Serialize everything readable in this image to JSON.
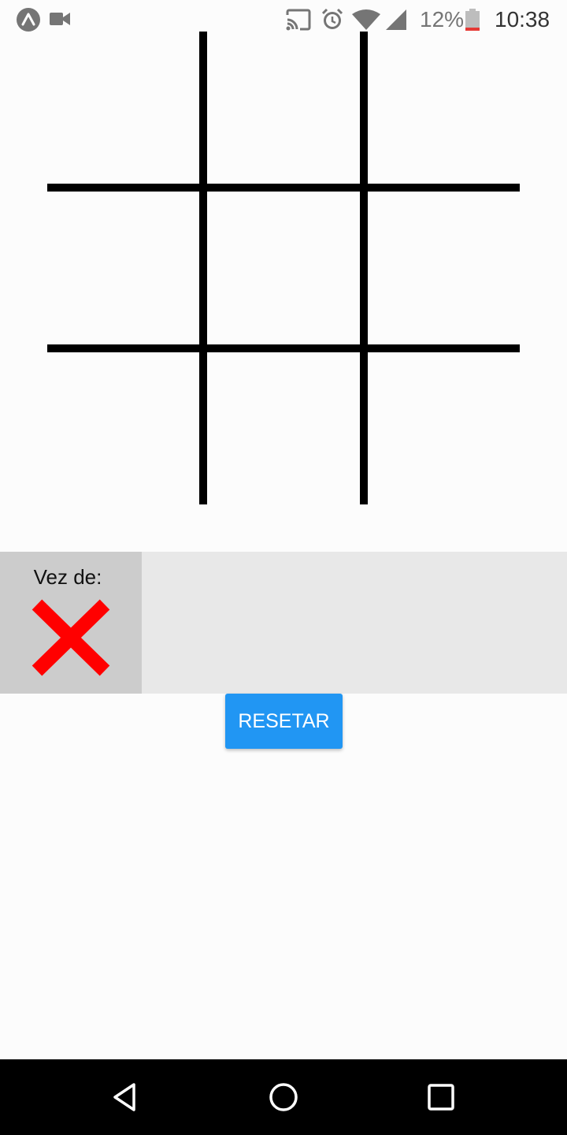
{
  "status_bar": {
    "icons_left": [
      "expo-icon",
      "video-camera-icon"
    ],
    "icons_right": [
      "cast-icon",
      "alarm-icon",
      "wifi-icon",
      "signal-icon",
      "battery-icon"
    ],
    "battery_percent": "12%",
    "clock": "10:38",
    "battery_low_color": "#e53935"
  },
  "board": {
    "rows": 3,
    "columns": 3,
    "cells": [
      "",
      "",
      "",
      "",
      "",
      "",
      "",
      "",
      ""
    ],
    "line_color": "#000000"
  },
  "turn_panel": {
    "label": "Vez de:",
    "current_player": "X",
    "player_icon": "x-mark-icon",
    "player_color": "#ff0000"
  },
  "reset_button": {
    "label": "RESETAR",
    "color": "#2196f3"
  },
  "nav_bar": {
    "buttons": [
      "back-icon",
      "home-icon",
      "recents-icon"
    ]
  }
}
